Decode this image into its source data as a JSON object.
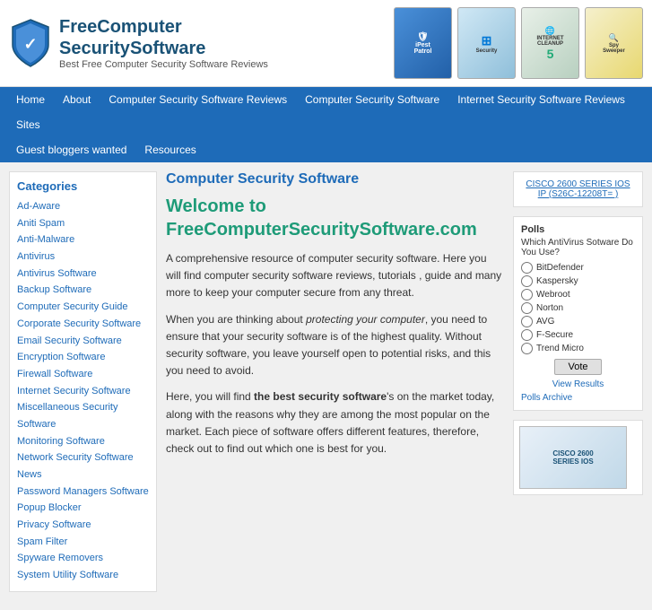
{
  "header": {
    "logo_free": "Free",
    "logo_computer": "Computer",
    "logo_security": "Security",
    "logo_software": "Software",
    "logo_subtitle": "Best Free Computer Security Software Reviews",
    "products": [
      {
        "name": "PestPatrol",
        "style": "pest",
        "label": "iPestPatrol"
      },
      {
        "name": "Windows",
        "style": "win",
        "label": "Windows Security"
      },
      {
        "name": "Internet Cleanup",
        "style": "internet",
        "label": "INTERNET CLEANUP 5"
      },
      {
        "name": "Spy Sweeper",
        "style": "spy",
        "label": "SpySweeper"
      }
    ]
  },
  "navbar": {
    "primary": [
      "Home",
      "About",
      "Computer Security Software Reviews",
      "Computer Security Software",
      "Internet Security Software Reviews",
      "Sites"
    ],
    "secondary": [
      "Guest bloggers wanted",
      "Resources"
    ]
  },
  "sidebar": {
    "title": "Categories",
    "items": [
      "Ad-Aware",
      "Aniti Spam",
      "Anti-Malware",
      "Antivirus",
      "Antivirus Software",
      "Backup Software",
      "Computer Security Guide",
      "Corporate Security Software",
      "Email Security Software",
      "Encryption Software",
      "Firewall Software",
      "Internet Security Software",
      "Miscellaneous Security Software",
      "Monitoring Software",
      "Network Security Software",
      "News",
      "Password Managers Software",
      "Popup Blocker",
      "Privacy Software",
      "Spam Filter",
      "Spyware Removers",
      "System Utility Software"
    ]
  },
  "main": {
    "title": "Computer Security Software",
    "welcome_heading": "Welcome to FreeComputerSecuritySoftware.com",
    "paragraph1": "A comprehensive resource of computer security software. Here you will find computer security software reviews, tutorials , guide and many more to keep your computer secure from any threat.",
    "paragraph2_start": "When you are thinking about ",
    "paragraph2_italic": "protecting your computer",
    "paragraph2_end": ", you need to ensure that your security software is of the highest quality. Without security software, you leave yourself open to potential risks, and this you need to avoid.",
    "paragraph3_start": "Here, you will find  ",
    "paragraph3_bold": "the best security software",
    "paragraph3_end": "'s on the market today, along with the reasons why they are among the most popular on the market. Each piece of software offers different features, therefore, check out to find out which one is best for you."
  },
  "right_sidebar": {
    "cisco_title": "CISCO 2600 SERIES IOS IP (S26C-12208T= )",
    "polls": {
      "label": "Polls",
      "question": "Which AntiVirus Sotware Do You Use?",
      "options": [
        "BitDefender",
        "Kaspersky",
        "Webroot",
        "Norton",
        "AVG",
        "F-Secure",
        "Trend Micro"
      ],
      "vote_label": "Vote",
      "results_label": "View Results",
      "archive_label": "Polls Archive"
    },
    "cisco_bottom_label": "CISCO 2600 SERIES IOS"
  }
}
